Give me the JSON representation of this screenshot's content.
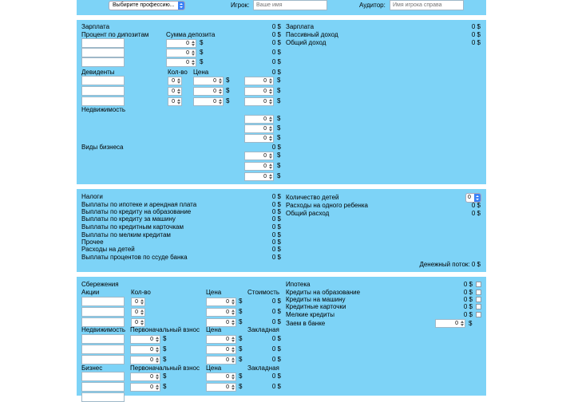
{
  "top": {
    "profession_select": "Выбирите профессию...",
    "player_label": "Игрок:",
    "player_placeholder": "Ваше имя",
    "auditor_label": "Аудитор:",
    "auditor_placeholder": "Имя игрока справа"
  },
  "income": {
    "salary_label": "Зарплата",
    "salary_value": "0 $",
    "deposit_percent_label": "Процент по дипозитам",
    "deposit_sum_label": "Сумма депозита",
    "deposit_rows": [
      {
        "amount": "0",
        "unit": "$",
        "value": "0 $"
      },
      {
        "amount": "0",
        "unit": "$",
        "value": "0 $"
      },
      {
        "amount": "0",
        "unit": "$",
        "value": "0 $"
      }
    ],
    "dividends_label": "Девиденты",
    "dividends_qty_label": "Кол-во",
    "dividends_price_label": "Цена",
    "dividends_value": "0 $",
    "dividend_rows": [
      {
        "qty": "0",
        "price": "0",
        "unit": "$",
        "amount": "0",
        "cur": "$"
      },
      {
        "qty": "0",
        "price": "0",
        "unit": "$",
        "amount": "0",
        "cur": "$"
      },
      {
        "qty": "0",
        "price": "0",
        "unit": "$",
        "amount": "0",
        "cur": "$"
      }
    ],
    "real_estate_label": "Недвижимость",
    "real_estate_rows": [
      {
        "amount": "0",
        "cur": "$"
      },
      {
        "amount": "0",
        "cur": "$"
      },
      {
        "amount": "0",
        "cur": "$"
      }
    ],
    "business_label": "Виды бизнеса",
    "business_value": "0 $",
    "business_rows": [
      {
        "amount": "0",
        "cur": "$"
      },
      {
        "amount": "0",
        "cur": "$"
      },
      {
        "amount": "0",
        "cur": "$"
      }
    ],
    "summary": [
      {
        "label": "Зарплата",
        "value": "0 $"
      },
      {
        "label": "Пассивный доход",
        "value": "0 $"
      },
      {
        "label": "Общий доход",
        "value": "0 $"
      }
    ]
  },
  "expenses": {
    "items": [
      {
        "label": "Налоги",
        "value": "0 $"
      },
      {
        "label": "Выплаты по ипотеке и арендная плата",
        "value": "0 $"
      },
      {
        "label": "Выплаты по кредиту на образование",
        "value": "0 $"
      },
      {
        "label": "Выплаты по кредиту за машину",
        "value": "0 $"
      },
      {
        "label": "Выплаты по кредитным карточкам",
        "value": "0 $"
      },
      {
        "label": "Выплаты по мелким кредитам",
        "value": "0 $"
      },
      {
        "label": "Прочее",
        "value": "0 $"
      },
      {
        "label": "Расходы на детей",
        "value": "0 $"
      },
      {
        "label": "Выплаты процентов по ссуде банка",
        "value": "0 $"
      }
    ],
    "children_label": "Количество детей",
    "children_count": "0",
    "per_child_label": "Расходы на одного ребенка",
    "per_child_value": "0 $",
    "total_label": "Общий расход",
    "total_value": "0 $",
    "cashflow": "Денежный поток: 0 $"
  },
  "assets": {
    "savings_label": "Сбережения",
    "stocks_label": "Акции",
    "qty_label": "Кол-во",
    "price_label": "Цена",
    "cost_label": "Стоимость",
    "stock_rows": [
      {
        "qty": "0",
        "price": "0",
        "cur": "$",
        "cost": "0 $"
      },
      {
        "qty": "0",
        "price": "0",
        "cur": "$",
        "cost": "0 $"
      },
      {
        "qty": "0",
        "price": "0",
        "cur": "$",
        "cost": "0 $"
      }
    ],
    "real_estate_label": "Недвижимость",
    "down_payment_label": "Первоначальный взнос",
    "price2_label": "Цена",
    "mortgage_label": "Закладная",
    "real_estate_rows": [
      {
        "down": "0",
        "cur": "$",
        "price": "0",
        "cur2": "$",
        "mortgage": "0 $"
      },
      {
        "down": "0",
        "cur": "$",
        "price": "0",
        "cur2": "$",
        "mortgage": "0 $"
      },
      {
        "down": "0",
        "cur": "$",
        "price": "0",
        "cur2": "$",
        "mortgage": "0 $"
      }
    ],
    "business_label": "Бизнес",
    "down_payment2_label": "Первоначальный взнос",
    "price3_label": "Цена",
    "mortgage2_label": "Закладная",
    "business_rows": [
      {
        "down": "0",
        "cur": "$",
        "price": "0",
        "cur2": "$",
        "mortgage": "0 $"
      },
      {
        "down": "0",
        "cur": "$",
        "price": "0",
        "cur2": "$",
        "mortgage": "0 $"
      }
    ],
    "liabilities": [
      {
        "label": "Ипотека",
        "value": "0 $"
      },
      {
        "label": "Кредиты на образование",
        "value": "0 $"
      },
      {
        "label": "Кредиты на машину",
        "value": "0 $"
      },
      {
        "label": "Кредитные карточки",
        "value": "0 $"
      },
      {
        "label": "Мелкие кредиты",
        "value": "0 $"
      }
    ],
    "bank_loan_label": "Заем в банке",
    "bank_loan_amount": "0",
    "bank_loan_cur": "$"
  },
  "colors": {
    "panel": "#7dd3f7",
    "background": "#ffffff",
    "select_accent": "#3b82f6"
  }
}
